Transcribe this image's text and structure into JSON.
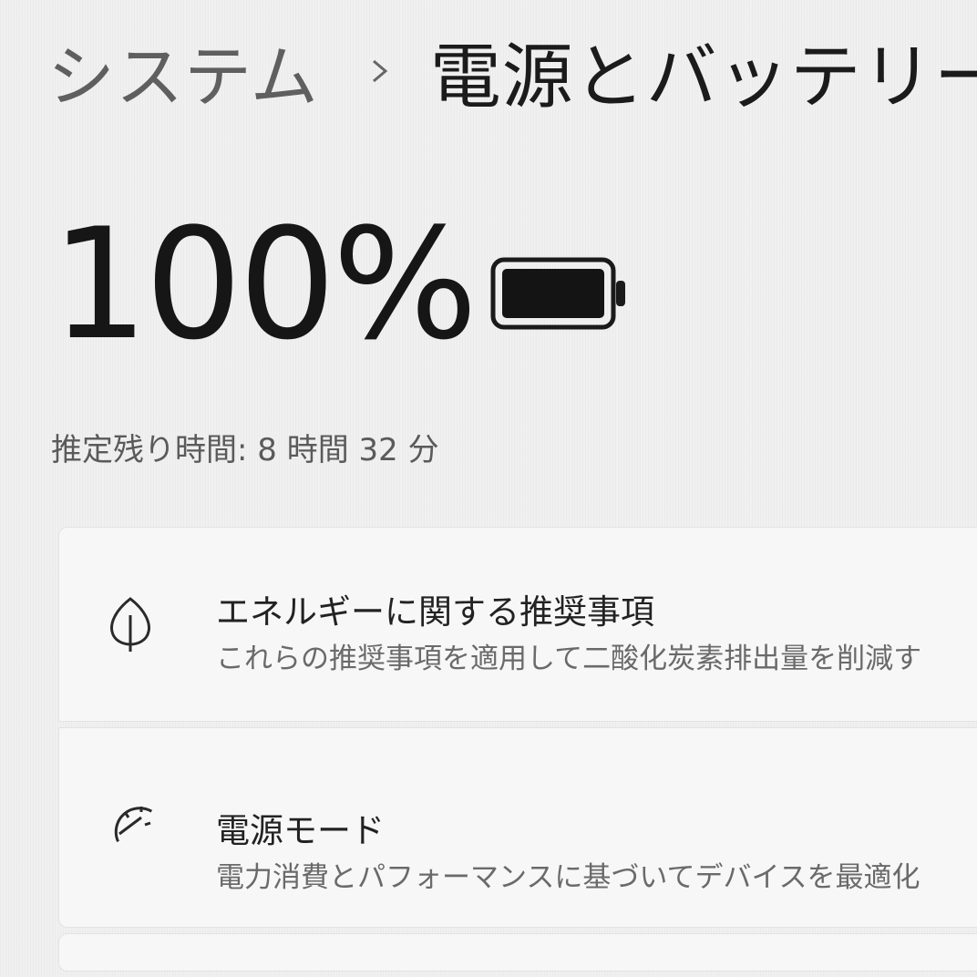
{
  "breadcrumb": {
    "parent": "システム",
    "separator_icon": "chevron-right-icon",
    "current": "電源とバッテリー"
  },
  "battery": {
    "percent_text": "100%",
    "level_fraction": 1.0,
    "icon": "battery-full-icon",
    "estimate_text": "推定残り時間: 8 時間 32 分"
  },
  "cards": [
    {
      "icon": "leaf-icon",
      "title": "エネルギーに関する推奨事項",
      "description": "これらの推奨事項を適用して二酸化炭素排出量を削減す"
    },
    {
      "icon": "gauge-icon",
      "title": "電源モード",
      "description": "電力消費とパフォーマンスに基づいてデバイスを最適化"
    }
  ]
}
